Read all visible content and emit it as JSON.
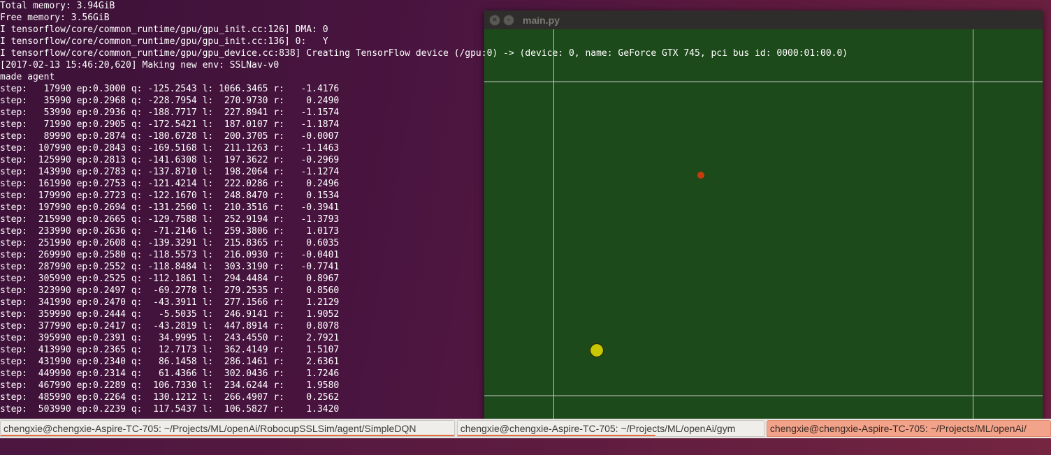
{
  "terminal": {
    "header_lines": [
      "Total memory: 3.94GiB",
      "Free memory: 3.56GiB",
      "I tensorflow/core/common_runtime/gpu/gpu_init.cc:126] DMA: 0",
      "I tensorflow/core/common_runtime/gpu/gpu_init.cc:136] 0:   Y",
      "",
      "[2017-02-13 15:46:20,620] Making new env: SSLNav-v0",
      "made agent"
    ],
    "device_line": "I tensorflow/core/common_runtime/gpu/gpu_device.cc:838] Creating TensorFlow device (/gpu:0) -> (device: 0, name: GeForce GTX 745, pci bus id: 0000:01:00.0)",
    "steps": [
      "step:   17990 ep:0.3000 q: -125.2543 l: 1066.3465 r:   -1.4176",
      "step:   35990 ep:0.2968 q: -228.7954 l:  270.9730 r:    0.2490",
      "step:   53990 ep:0.2936 q: -188.7717 l:  227.8941 r:   -1.1574",
      "step:   71990 ep:0.2905 q: -172.5421 l:  187.0107 r:   -1.1874",
      "step:   89990 ep:0.2874 q: -180.6728 l:  200.3705 r:   -0.0007",
      "step:  107990 ep:0.2843 q: -169.5168 l:  211.1263 r:   -1.1463",
      "step:  125990 ep:0.2813 q: -141.6308 l:  197.3622 r:   -0.2969",
      "step:  143990 ep:0.2783 q: -137.8710 l:  198.2064 r:   -1.1274",
      "step:  161990 ep:0.2753 q: -121.4214 l:  222.0286 r:    0.2496",
      "step:  179990 ep:0.2723 q: -122.1670 l:  248.8470 r:    0.1534",
      "step:  197990 ep:0.2694 q: -131.2560 l:  210.3516 r:   -0.3941",
      "step:  215990 ep:0.2665 q: -129.7588 l:  252.9194 r:   -1.3793",
      "step:  233990 ep:0.2636 q:  -71.2146 l:  259.3806 r:    1.0173",
      "step:  251990 ep:0.2608 q: -139.3291 l:  215.8365 r:    0.6035",
      "step:  269990 ep:0.2580 q: -118.5573 l:  216.0930 r:   -0.0401",
      "step:  287990 ep:0.2552 q: -118.8484 l:  303.3190 r:   -0.7741",
      "step:  305990 ep:0.2525 q: -112.1861 l:  294.4484 r:    0.8967",
      "step:  323990 ep:0.2497 q:  -69.2778 l:  279.2535 r:    0.8560",
      "step:  341990 ep:0.2470 q:  -43.3911 l:  277.1566 r:    1.2129",
      "step:  359990 ep:0.2444 q:   -5.5035 l:  246.9141 r:    1.9052",
      "step:  377990 ep:0.2417 q:  -43.2819 l:  447.8914 r:    0.8078",
      "step:  395990 ep:0.2391 q:   34.9995 l:  243.4550 r:    2.7921",
      "step:  413990 ep:0.2365 q:   12.7173 l:  362.4149 r:    1.5107",
      "step:  431990 ep:0.2340 q:   86.1458 l:  286.1461 r:    2.6361",
      "step:  449990 ep:0.2314 q:   61.4366 l:  302.0436 r:    1.7246",
      "step:  467990 ep:0.2289 q:  106.7330 l:  234.6244 r:    1.9580",
      "step:  485990 ep:0.2264 q:  130.1212 l:  266.4907 r:    0.2562",
      "step:  503990 ep:0.2239 q:  117.5437 l:  106.5827 r:    1.3420"
    ]
  },
  "game_window": {
    "title": "main.py",
    "close_glyph": "×",
    "minimize_glyph": "–",
    "field_color": "#1d4a1a",
    "line_color": "#c8c8c8",
    "ball_color": "#c43e0c",
    "robot_color": "#c8c800"
  },
  "tabs": [
    {
      "label": "chengxie@chengxie-Aspire-TC-705: ~/Projects/ML/openAi/RobocupSSLSim/agent/SimpleDQN",
      "active": false
    },
    {
      "label": "chengxie@chengxie-Aspire-TC-705: ~/Projects/ML/openAi/gym",
      "active": false
    },
    {
      "label": "chengxie@chengxie-Aspire-TC-705: ~/Projects/ML/openAi/",
      "active": true
    }
  ]
}
